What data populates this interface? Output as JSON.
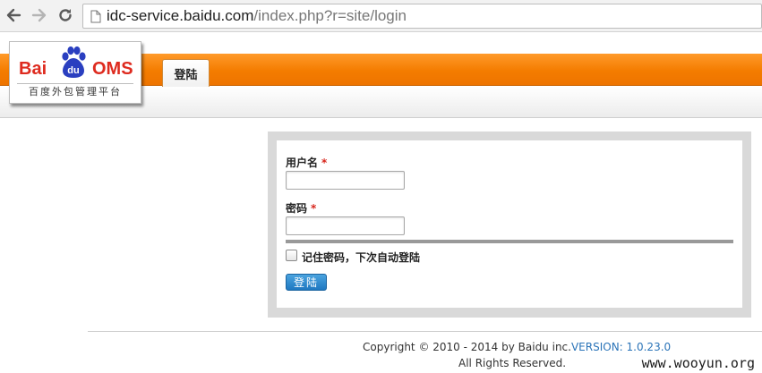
{
  "browser": {
    "url_host": "idc-service.baidu.com",
    "url_path": "/index.php?r=site/login",
    "back_icon": "back-arrow-icon",
    "forward_icon": "forward-arrow-icon",
    "reload_icon": "reload-icon",
    "page_icon": "page-icon"
  },
  "header": {
    "logo_left": "Bai",
    "logo_paw_text": "du",
    "logo_right": "OMS",
    "logo_subtitle": "百度外包管理平台",
    "tab_label": "登陆",
    "accent_color": "#f47c00",
    "brand_red": "#de2b1f"
  },
  "login": {
    "username_label": "用户名",
    "password_label": "密码",
    "required_mark": "*",
    "username_value": "",
    "password_value": "",
    "remember_label": "记住密码，下次自动登陆",
    "remember_checked": false,
    "submit_label": "登陆"
  },
  "footer": {
    "copyright_text": "Copyright © 2010 - 2014 by Baidu inc.",
    "version_text": "VERSION: 1.0.23.0",
    "rights_text": "All Rights Reserved.",
    "watermark": "www.wooyun.org"
  }
}
